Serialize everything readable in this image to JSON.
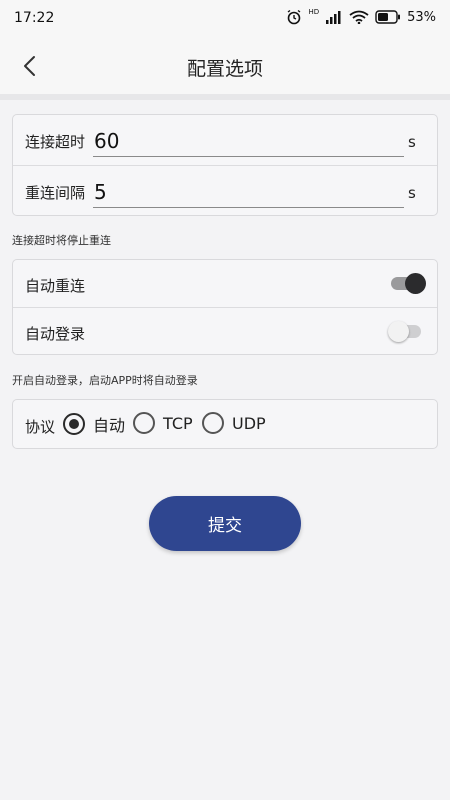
{
  "status_bar": {
    "time": "17:22",
    "battery": "53%",
    "hd_label": "HD"
  },
  "header": {
    "title": "配置选项"
  },
  "connection": {
    "timeout_label": "连接超时",
    "timeout_value": "60",
    "timeout_unit": "s",
    "interval_label": "重连间隔",
    "interval_value": "5",
    "interval_unit": "s",
    "hint": "连接超时将停止重连"
  },
  "toggles": {
    "auto_reconnect_label": "自动重连",
    "auto_reconnect_on": true,
    "auto_login_label": "自动登录",
    "auto_login_on": false,
    "hint": "开启自动登录，启动APP时将自动登录"
  },
  "protocol": {
    "label": "协议",
    "options": [
      "自动",
      "TCP",
      "UDP"
    ],
    "selected": "自动"
  },
  "submit_label": "提交",
  "colors": {
    "accent": "#2f4690",
    "background": "#f3f3f5"
  }
}
